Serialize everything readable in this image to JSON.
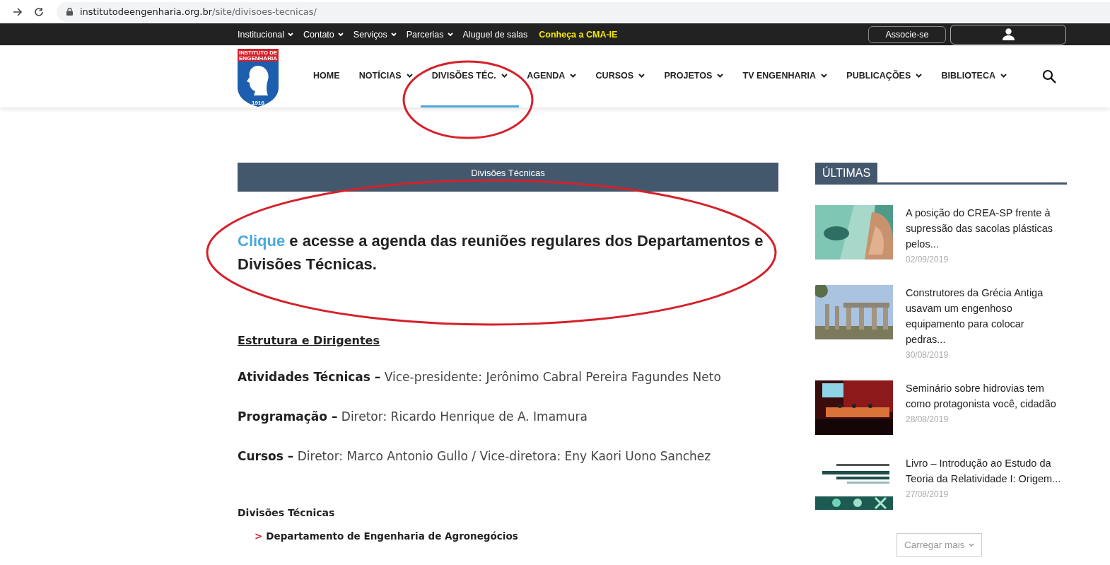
{
  "browser": {
    "url_host": "institutodeengenharia.org.br",
    "url_path": "/site/divisoes-tecnicas/"
  },
  "top_bar": {
    "links": [
      {
        "label": "Institucional",
        "dropdown": true,
        "kind": "normal"
      },
      {
        "label": "Contato",
        "dropdown": true,
        "kind": "normal"
      },
      {
        "label": "Serviços",
        "dropdown": true,
        "kind": "normal"
      },
      {
        "label": "Parcerias",
        "dropdown": true,
        "kind": "normal"
      },
      {
        "label": "Aluguel de salas",
        "dropdown": false,
        "kind": "normal"
      },
      {
        "label": "Conheça a CMA-IE",
        "dropdown": false,
        "kind": "highlight"
      }
    ],
    "join_button": "Associe-se"
  },
  "logo": {
    "line1": "INSTITUTO DE",
    "line2": "ENGENHARIA",
    "year": "1916"
  },
  "nav": [
    {
      "label": "HOME",
      "dropdown": false,
      "selected": false
    },
    {
      "label": "NOTÍCIAS",
      "dropdown": true,
      "selected": false
    },
    {
      "label": "DIVISÕES TÉC.",
      "dropdown": true,
      "selected": true
    },
    {
      "label": "AGENDA",
      "dropdown": true,
      "selected": false
    },
    {
      "label": "CURSOS",
      "dropdown": true,
      "selected": false
    },
    {
      "label": "PROJETOS",
      "dropdown": true,
      "selected": false
    },
    {
      "label": "TV ENGENHARIA",
      "dropdown": true,
      "selected": false
    },
    {
      "label": "PUBLICAÇÕES",
      "dropdown": true,
      "selected": false
    },
    {
      "label": "BIBLIOTECA",
      "dropdown": true,
      "selected": false
    }
  ],
  "content": {
    "header_title": "Divisões Técnicas",
    "intro": {
      "link": "Clique",
      "text": "e acesse a agenda das reuniões regulares dos Departamentos e Divisões Técnicas."
    },
    "section_heading": "Estrutura e Dirigentes",
    "roles": [
      {
        "title": "Atividades Técnicas –",
        "text": "Vice-presidente: Jerônimo Cabral Pereira Fagundes Neto"
      },
      {
        "title": "Programação –",
        "text": "Diretor: Ricardo Henrique de A. Imamura"
      },
      {
        "title": "Cursos –",
        "text": "Diretor: Marco Antonio Gullo / Vice-diretora: Eny Kaori Uono Sanchez"
      }
    ],
    "divisions_heading": "Divisões Técnicas",
    "divisions": [
      {
        "marker": ">",
        "label": "Departamento de Engenharia de Agronegócios"
      }
    ]
  },
  "sidebar": {
    "title": "ÚLTIMAS",
    "posts": [
      {
        "title": "A posição do CREA-SP frente à supressão das sacolas plásticas pelos...",
        "date": "02/09/2019",
        "kind": "bags"
      },
      {
        "title": "Construtores da Grécia Antiga usavam um engenhoso equipamento para colocar pedras...",
        "date": "30/08/2019",
        "kind": "temple"
      },
      {
        "title": "Seminário sobre hidrovias tem como protagonista você, cidadão",
        "date": "28/08/2019",
        "kind": "stage"
      },
      {
        "title": "Livro – Introdução ao Estudo da Teoria da Relatividade I: Origem...",
        "date": "27/08/2019",
        "kind": "book"
      }
    ],
    "load_more": "Carregar mais"
  }
}
